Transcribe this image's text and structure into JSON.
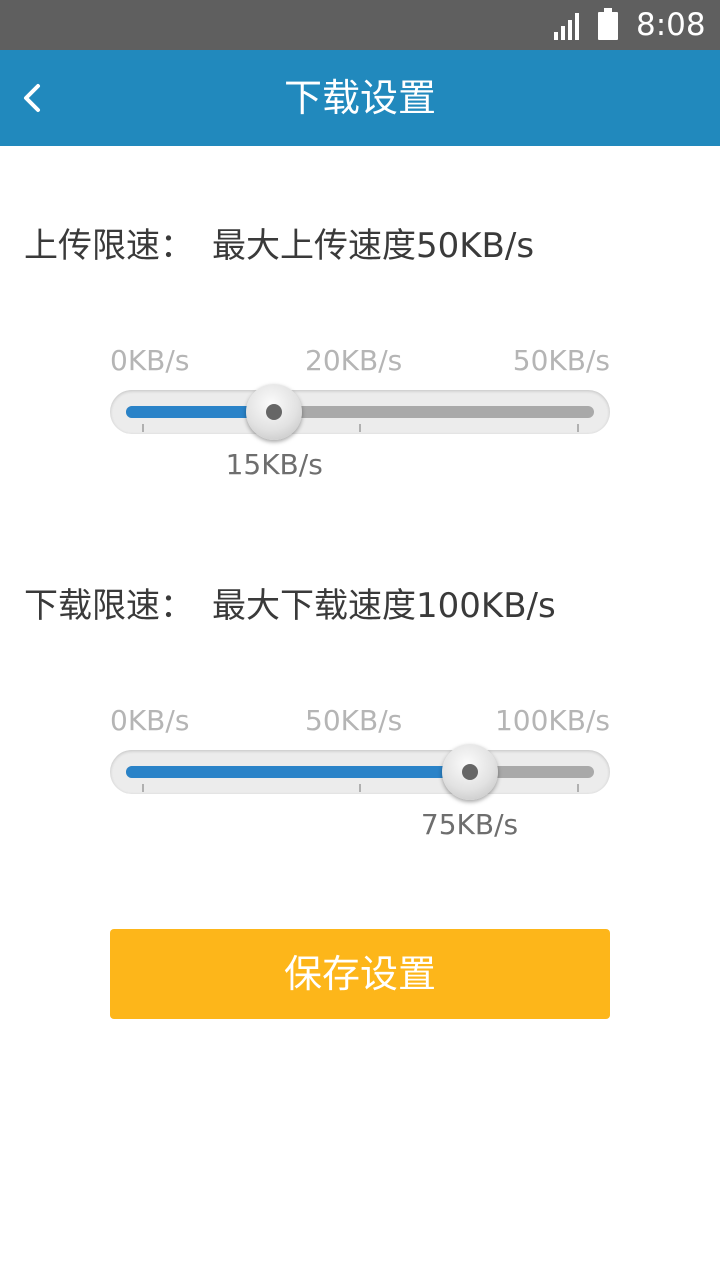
{
  "status_bar": {
    "time": "8:08",
    "icons": [
      "signal-icon",
      "battery-icon"
    ]
  },
  "app_bar": {
    "title": "下载设置",
    "back_icon": "chevron-left-icon"
  },
  "upload": {
    "label_key": "上传限速：",
    "label_value": "最大上传速度50KB/s",
    "ticks": [
      "0KB/s",
      "20KB/s",
      "50KB/s"
    ],
    "min": 0,
    "max": 50,
    "value": 15,
    "value_label": "15KB/s"
  },
  "download": {
    "label_key": "下载限速：",
    "label_value": "最大下载速度100KB/s",
    "ticks": [
      "0KB/s",
      "50KB/s",
      "100KB/s"
    ],
    "min": 0,
    "max": 100,
    "value": 75,
    "value_label": "75KB/s"
  },
  "save_button": {
    "label": "保存设置"
  },
  "colors": {
    "app_bar": "#2189bd",
    "status_bar": "#5f5f5f",
    "slider_fill": "#2a83c8",
    "save_button": "#fdb61a"
  }
}
